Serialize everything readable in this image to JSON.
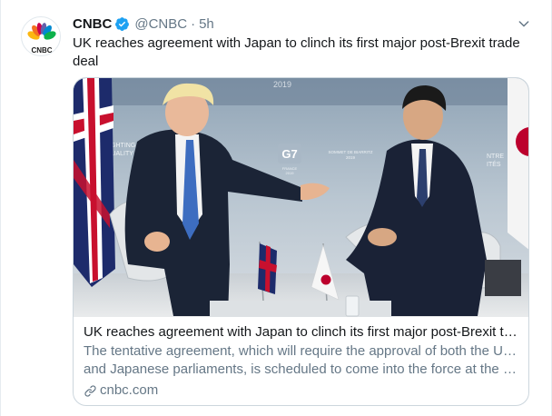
{
  "tweet": {
    "display_name": "CNBC",
    "handle": "@CNBC",
    "separator": "·",
    "time": "5h",
    "text": "UK reaches agreement with Japan to clinch its first major post-Brexit trade deal"
  },
  "avatar": {
    "label": "CNBC",
    "peacock_colors": [
      "#fcb711",
      "#f37021",
      "#cc004c",
      "#6460aa",
      "#0089d0",
      "#0db14b"
    ]
  },
  "card": {
    "image": {
      "backdrop_text_left": "UGHTING\nQUALITY",
      "backdrop_logo": "G7",
      "backdrop_logo_sub": "FRANCE\n2019",
      "backdrop_text_mid": "SOMMET DE BIARRITZ\n2019",
      "backdrop_text_right": "NTRE\nITÉS",
      "backdrop_top_text": "2019"
    },
    "title": "UK reaches agreement with Japan to clinch its first major post-Brexit tra...",
    "description_line1": "The tentative agreement, which will require the approval of both the U.K.",
    "description_line2": "and Japanese parliaments, is scheduled to come into the force at the en...",
    "domain": "cnbc.com"
  },
  "colors": {
    "verified_blue": "#1da1f2",
    "text_primary": "#14171a",
    "text_secondary": "#657786",
    "border": "#ccd6dd"
  },
  "icons": {
    "verified": "verified-badge-icon",
    "caret": "chevron-down-icon",
    "link": "link-icon"
  }
}
